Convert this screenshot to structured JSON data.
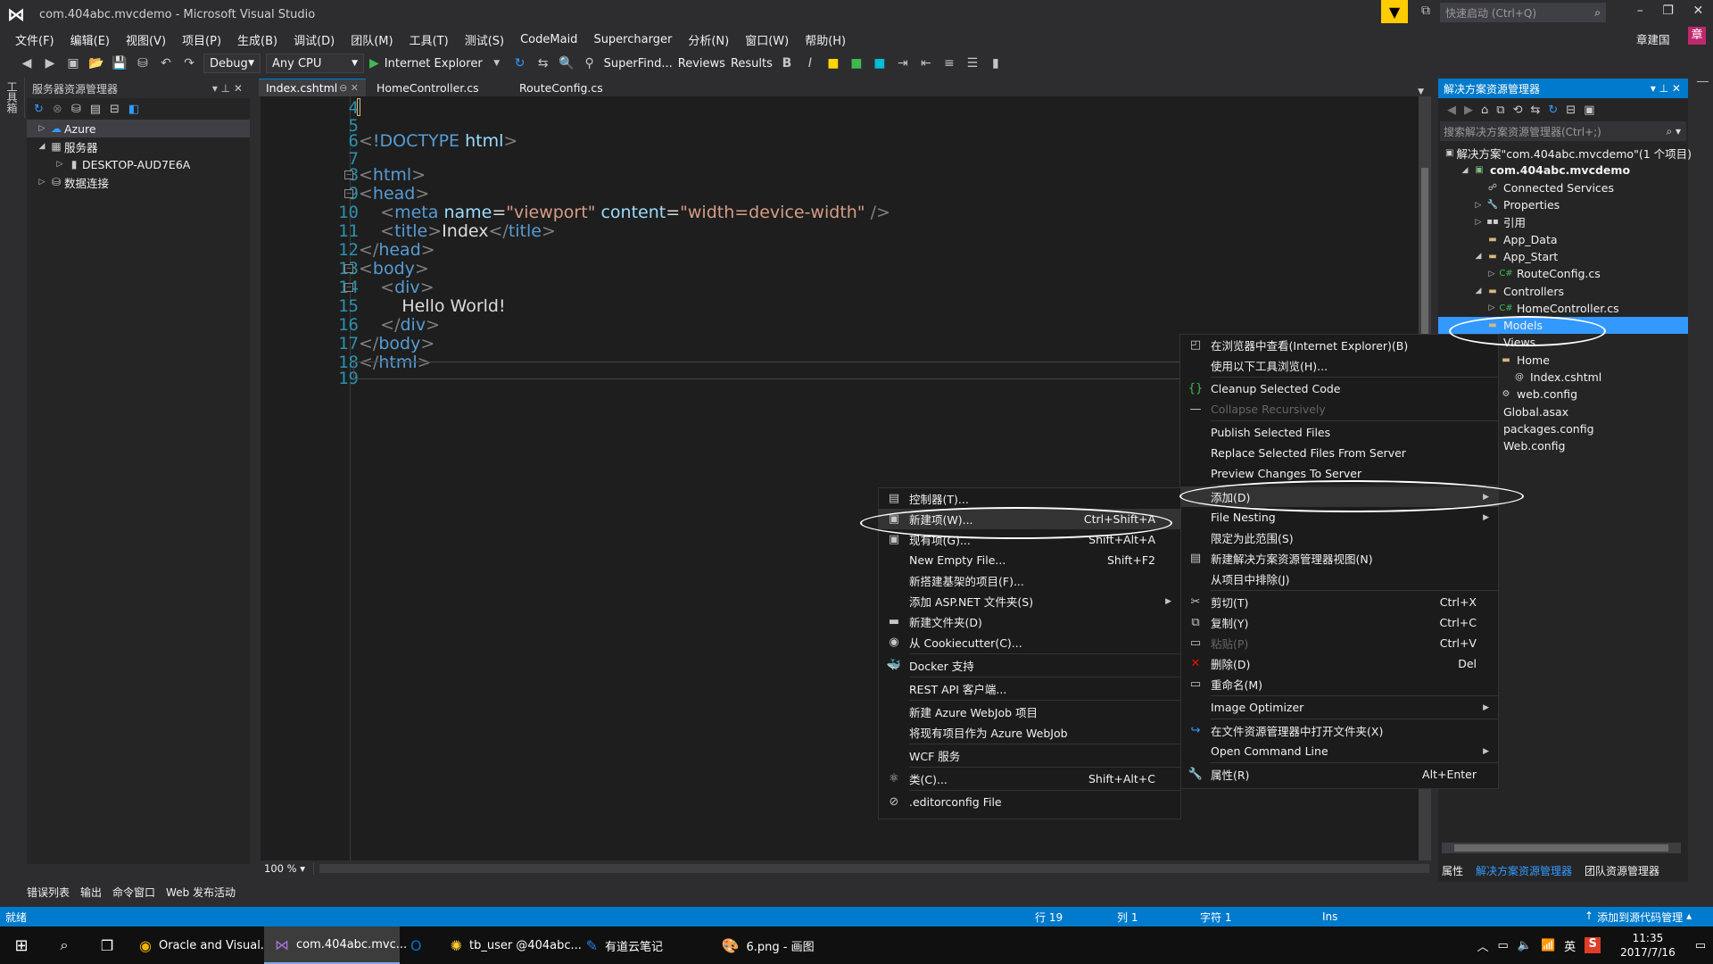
{
  "window": {
    "title": "com.404abc.mvcdemo - Microsoft Visual Studio",
    "quick_launch_placeholder": "快速启动 (Ctrl+Q)",
    "user": "章建国"
  },
  "menu": [
    "文件(F)",
    "编辑(E)",
    "视图(V)",
    "项目(P)",
    "生成(B)",
    "调试(D)",
    "团队(M)",
    "工具(T)",
    "测试(S)",
    "CodeMaid",
    "Supercharger",
    "分析(N)",
    "窗口(W)",
    "帮助(H)"
  ],
  "toolbar": {
    "config": "Debug",
    "platform": "Any CPU",
    "run": "Internet Explorer",
    "superfind": "SuperFind...",
    "reviews": "Reviews",
    "results": "Results"
  },
  "left_vtab": "工具箱",
  "server_explorer": {
    "title": "服务器资源管理器",
    "items": [
      {
        "label": "Azure",
        "level": 0
      },
      {
        "label": "服务器",
        "level": 0
      },
      {
        "label": "DESKTOP-AUD7E6A",
        "level": 1
      },
      {
        "label": "数据连接",
        "level": 0
      }
    ]
  },
  "tabs": [
    {
      "label": "Index.cshtml",
      "active": true
    },
    {
      "label": "HomeController.cs",
      "active": false
    },
    {
      "label": "RouteConfig.cs",
      "active": false
    }
  ],
  "code_lines": [
    {
      "n": "4",
      "code": [
        {
          "t": "pun",
          "v": ""
        }
      ]
    },
    {
      "n": "5",
      "code": []
    },
    {
      "n": "6",
      "code": [
        {
          "t": "pun",
          "v": "<"
        },
        {
          "t": "tag",
          "v": "!DOCTYPE "
        },
        {
          "t": "attr",
          "v": "html"
        },
        {
          "t": "pun",
          "v": ">"
        }
      ]
    },
    {
      "n": "7",
      "code": []
    },
    {
      "n": "8",
      "code": [
        {
          "t": "pun",
          "v": "<"
        },
        {
          "t": "tag",
          "v": "html"
        },
        {
          "t": "pun",
          "v": ">"
        }
      ]
    },
    {
      "n": "9",
      "code": [
        {
          "t": "pun",
          "v": "<"
        },
        {
          "t": "tag",
          "v": "head"
        },
        {
          "t": "pun",
          "v": ">"
        }
      ]
    },
    {
      "n": "10",
      "code": [
        {
          "t": "txt",
          "v": "    "
        },
        {
          "t": "pun",
          "v": "<"
        },
        {
          "t": "tag",
          "v": "meta "
        },
        {
          "t": "attr",
          "v": "name"
        },
        {
          "t": "txt",
          "v": "="
        },
        {
          "t": "str",
          "v": "\"viewport\" "
        },
        {
          "t": "attr",
          "v": "content"
        },
        {
          "t": "txt",
          "v": "="
        },
        {
          "t": "str",
          "v": "\"width=device-width\""
        },
        {
          "t": "pun",
          "v": " />"
        }
      ]
    },
    {
      "n": "11",
      "code": [
        {
          "t": "txt",
          "v": "    "
        },
        {
          "t": "pun",
          "v": "<"
        },
        {
          "t": "tag",
          "v": "title"
        },
        {
          "t": "pun",
          "v": ">"
        },
        {
          "t": "txt",
          "v": "Index"
        },
        {
          "t": "pun",
          "v": "</"
        },
        {
          "t": "tag",
          "v": "title"
        },
        {
          "t": "pun",
          "v": ">"
        }
      ]
    },
    {
      "n": "12",
      "code": [
        {
          "t": "pun",
          "v": "</"
        },
        {
          "t": "tag",
          "v": "head"
        },
        {
          "t": "pun",
          "v": ">"
        }
      ]
    },
    {
      "n": "13",
      "code": [
        {
          "t": "pun",
          "v": "<"
        },
        {
          "t": "tag",
          "v": "body"
        },
        {
          "t": "pun",
          "v": ">"
        }
      ]
    },
    {
      "n": "14",
      "code": [
        {
          "t": "txt",
          "v": "    "
        },
        {
          "t": "pun",
          "v": "<"
        },
        {
          "t": "tag",
          "v": "div"
        },
        {
          "t": "pun",
          "v": ">"
        }
      ]
    },
    {
      "n": "15",
      "code": [
        {
          "t": "txt",
          "v": "        Hello World!"
        }
      ]
    },
    {
      "n": "16",
      "code": [
        {
          "t": "txt",
          "v": "    "
        },
        {
          "t": "pun",
          "v": "</"
        },
        {
          "t": "tag",
          "v": "div"
        },
        {
          "t": "pun",
          "v": ">"
        }
      ]
    },
    {
      "n": "17",
      "code": [
        {
          "t": "pun",
          "v": "</"
        },
        {
          "t": "tag",
          "v": "body"
        },
        {
          "t": "pun",
          "v": ">"
        }
      ]
    },
    {
      "n": "18",
      "code": [
        {
          "t": "pun",
          "v": "</"
        },
        {
          "t": "tag",
          "v": "html"
        },
        {
          "t": "pun",
          "v": ">"
        }
      ]
    },
    {
      "n": "19",
      "code": []
    }
  ],
  "zoom": "100 %",
  "solution_explorer": {
    "title": "解决方案资源管理器",
    "search_placeholder": "搜索解决方案资源管理器(Ctrl+;)",
    "items": [
      {
        "label": "解决方案\"com.404abc.mvcdemo\"(1 个项目)",
        "level": 0,
        "icon": "solution-icon"
      },
      {
        "label": "com.404abc.mvcdemo",
        "level": 1,
        "icon": "project-icon",
        "bold": true
      },
      {
        "label": "Connected Services",
        "level": 2,
        "icon": "connected-services-icon"
      },
      {
        "label": "Properties",
        "level": 2,
        "icon": "wrench-icon"
      },
      {
        "label": "引用",
        "level": 2,
        "icon": "references-icon"
      },
      {
        "label": "App_Data",
        "level": 2,
        "icon": "folder-icon"
      },
      {
        "label": "App_Start",
        "level": 2,
        "icon": "folder-icon"
      },
      {
        "label": "RouteConfig.cs",
        "level": 3,
        "icon": "csharp-file-icon"
      },
      {
        "label": "Controllers",
        "level": 2,
        "icon": "folder-icon"
      },
      {
        "label": "HomeController.cs",
        "level": 3,
        "icon": "csharp-file-icon"
      },
      {
        "label": "Models",
        "level": 2,
        "icon": "folder-icon",
        "selected": true
      },
      {
        "label": "Views",
        "level": 2,
        "icon": "folder-icon"
      },
      {
        "label": "Home",
        "level": 3,
        "icon": "folder-icon"
      },
      {
        "label": "Index.cshtml",
        "level": 4,
        "icon": "cshtml-file-icon"
      },
      {
        "label": "web.config",
        "level": 3,
        "icon": "config-file-icon"
      },
      {
        "label": "Global.asax",
        "level": 2,
        "icon": "asax-file-icon"
      },
      {
        "label": "packages.config",
        "level": 2,
        "icon": "config-file-icon"
      },
      {
        "label": "Web.config",
        "level": 2,
        "icon": "config-file-icon"
      }
    ],
    "bottom_tabs": [
      "属性",
      "解决方案资源管理器",
      "团队资源管理器"
    ]
  },
  "context_menu": [
    {
      "label": "在浏览器中查看(Internet Explorer)(B)",
      "icon": "browser-icon"
    },
    {
      "label": "使用以下工具浏览(H)...",
      "icon": ""
    },
    {
      "sep": true
    },
    {
      "label": "Cleanup Selected Code",
      "icon": "braces-icon"
    },
    {
      "label": "Collapse Recursively",
      "icon": "collapse-icon",
      "disabled": true
    },
    {
      "sep": true
    },
    {
      "label": "Publish Selected Files",
      "icon": ""
    },
    {
      "label": "Replace Selected Files From Server",
      "icon": ""
    },
    {
      "label": "Preview Changes To Server",
      "icon": ""
    },
    {
      "sep": true
    },
    {
      "label": "添加(D)",
      "icon": "",
      "submenu": true,
      "highlight": true
    },
    {
      "label": "File Nesting",
      "icon": "",
      "submenu": true
    },
    {
      "label": "限定为此范围(S)",
      "icon": ""
    },
    {
      "label": "新建解决方案资源管理器视图(N)",
      "icon": "new-view-icon"
    },
    {
      "label": "从项目中排除(J)",
      "icon": ""
    },
    {
      "sep": true
    },
    {
      "label": "剪切(T)",
      "shortcut": "Ctrl+X",
      "icon": "scissors-icon"
    },
    {
      "label": "复制(Y)",
      "shortcut": "Ctrl+C",
      "icon": "copy-icon"
    },
    {
      "label": "粘贴(P)",
      "shortcut": "Ctrl+V",
      "icon": "paste-icon",
      "disabled": true
    },
    {
      "label": "删除(D)",
      "shortcut": "Del",
      "icon": "delete-icon"
    },
    {
      "label": "重命名(M)",
      "icon": "rename-icon"
    },
    {
      "sep": true
    },
    {
      "label": "Image Optimizer",
      "icon": "",
      "submenu": true
    },
    {
      "sep": true
    },
    {
      "label": "在文件资源管理器中打开文件夹(X)",
      "icon": "open-folder-icon"
    },
    {
      "label": "Open Command Line",
      "icon": "",
      "submenu": true
    },
    {
      "sep": true
    },
    {
      "label": "属性(R)",
      "shortcut": "Alt+Enter",
      "icon": "properties-wrench-icon"
    }
  ],
  "add_submenu": [
    {
      "label": "控制器(T)...",
      "icon": "controller-icon"
    },
    {
      "label": "新建项(W)...",
      "shortcut": "Ctrl+Shift+A",
      "icon": "new-item-icon",
      "highlight": true
    },
    {
      "label": "现有项(G)...",
      "shortcut": "Shift+Alt+A",
      "icon": "existing-item-icon"
    },
    {
      "label": "New Empty File...",
      "shortcut": "Shift+F2",
      "icon": ""
    },
    {
      "label": "新搭建基架的项目(F)...",
      "icon": ""
    },
    {
      "label": "添加 ASP.NET 文件夹(S)",
      "icon": "",
      "submenu": true
    },
    {
      "label": "新建文件夹(D)",
      "icon": "new-folder-icon"
    },
    {
      "label": "从 Cookiecutter(C)...",
      "icon": "cookiecutter-icon"
    },
    {
      "sep": true
    },
    {
      "label": "Docker 支持",
      "icon": "docker-icon"
    },
    {
      "sep": true
    },
    {
      "label": "REST API 客户端...",
      "icon": ""
    },
    {
      "sep": true
    },
    {
      "label": "新建 Azure WebJob 项目",
      "icon": ""
    },
    {
      "label": "将现有项目作为 Azure WebJob",
      "icon": ""
    },
    {
      "sep": true
    },
    {
      "label": "WCF 服务",
      "icon": ""
    },
    {
      "sep": true
    },
    {
      "label": "类(C)...",
      "shortcut": "Shift+Alt+C",
      "icon": "class-icon"
    },
    {
      "sep": true
    },
    {
      "label": ".editorconfig File",
      "icon": "editorconfig-icon"
    }
  ],
  "bottom_tabs": [
    "错误列表",
    "输出",
    "命令窗口",
    "Web 发布活动"
  ],
  "status": {
    "ready": "就绪",
    "line": "行 19",
    "col": "列 1",
    "char": "字符 1",
    "mode": "Ins",
    "source_control": "添加到源代码管理"
  },
  "taskbar": {
    "tasks": [
      {
        "label": "Oracle and Visual...",
        "icon": "chrome-icon"
      },
      {
        "label": "com.404abc.mvc...",
        "icon": "visual-studio-icon",
        "active": true
      },
      {
        "label": "",
        "icon": "outlook-icon"
      },
      {
        "label": "tb_user @404abc...",
        "icon": "navicat-icon"
      },
      {
        "label": "有道云笔记",
        "icon": "youdao-note-icon"
      },
      {
        "label": "6.png - 画图",
        "icon": "paint-icon"
      }
    ],
    "time": "11:35",
    "date": "2017/7/16",
    "ime": "英"
  },
  "colors": {
    "accent": "#007acc",
    "selection": "#3399ff",
    "bg": "#2d2d30",
    "editor_bg": "#1e1e1e"
  }
}
